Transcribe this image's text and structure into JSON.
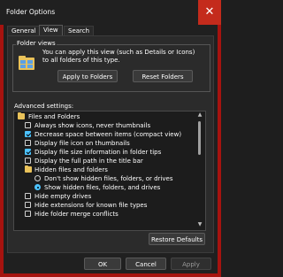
{
  "window": {
    "title": "Folder Options",
    "close_glyph": "✕"
  },
  "tabs": [
    {
      "label": "General",
      "active": false
    },
    {
      "label": "View",
      "active": true
    },
    {
      "label": "Search",
      "active": false
    }
  ],
  "folder_views": {
    "label": "Folder views",
    "description": "You can apply this view (such as Details or Icons) to all folders of this type.",
    "apply_button": "Apply to Folders",
    "reset_button": "Reset Folders",
    "icon": "folder-views-icon"
  },
  "advanced": {
    "label": "Advanced settings:",
    "items": [
      {
        "label": "Files and Folders",
        "kind": "folder",
        "level": 0
      },
      {
        "label": "Always show icons, never thumbnails",
        "kind": "checkbox",
        "checked": false,
        "level": 1
      },
      {
        "label": "Decrease space between items (compact view)",
        "kind": "checkbox",
        "checked": true,
        "level": 1
      },
      {
        "label": "Display file icon on thumbnails",
        "kind": "checkbox",
        "checked": false,
        "level": 1
      },
      {
        "label": "Display file size information in folder tips",
        "kind": "checkbox",
        "checked": true,
        "level": 1
      },
      {
        "label": "Display the full path in the title bar",
        "kind": "checkbox",
        "checked": false,
        "level": 1
      },
      {
        "label": "Hidden files and folders",
        "kind": "folder",
        "level": 1
      },
      {
        "label": "Don't show hidden files, folders, or drives",
        "kind": "radio",
        "checked": false,
        "level": 2
      },
      {
        "label": "Show hidden files, folders, and drives",
        "kind": "radio",
        "checked": true,
        "level": 2
      },
      {
        "label": "Hide empty drives",
        "kind": "checkbox",
        "checked": false,
        "level": 1
      },
      {
        "label": "Hide extensions for known file types",
        "kind": "checkbox",
        "checked": false,
        "level": 1
      },
      {
        "label": "Hide folder merge conflicts",
        "kind": "checkbox",
        "checked": false,
        "level": 1
      }
    ],
    "restore_button": "Restore Defaults"
  },
  "footer": {
    "ok": "OK",
    "cancel": "Cancel",
    "apply": "Apply"
  },
  "colors": {
    "accent": "#4cc2ff",
    "close_red": "#c42b1c",
    "border_red": "#a6130f"
  }
}
